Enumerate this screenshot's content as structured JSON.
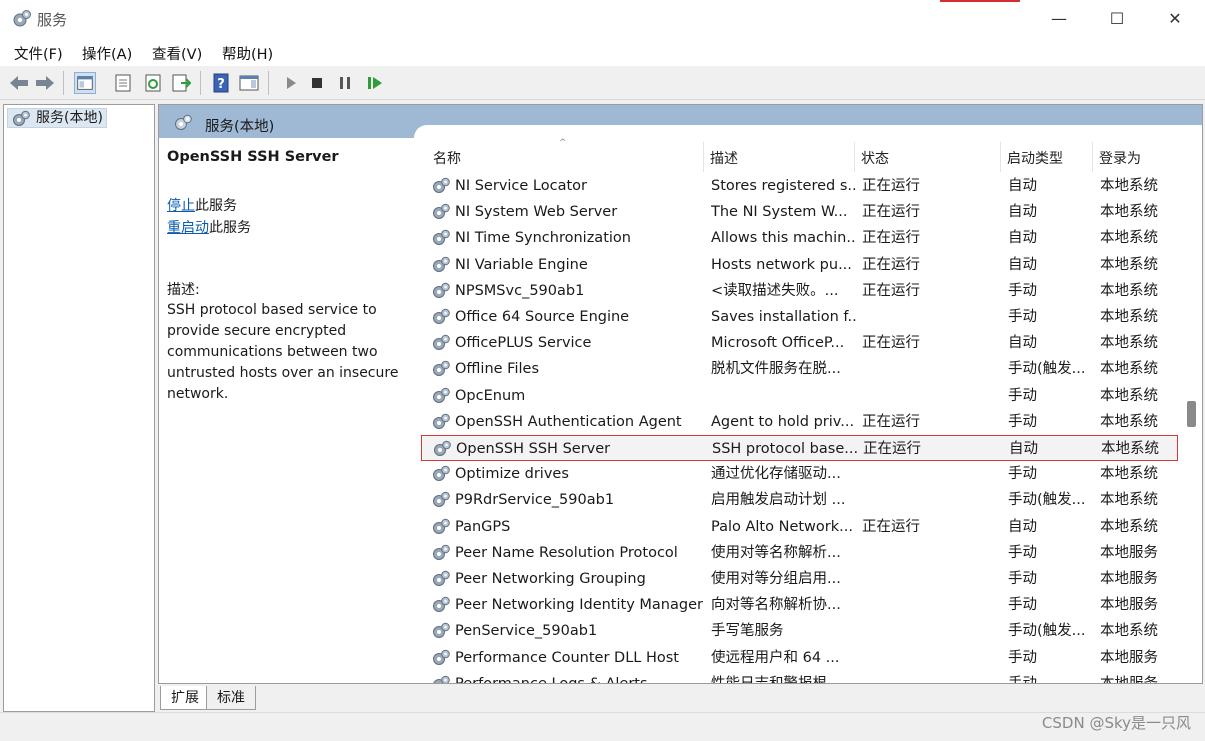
{
  "window": {
    "title": "服务",
    "minimize": "—",
    "maximize": "☐",
    "close": "✕"
  },
  "menu": [
    "文件(F)",
    "操作(A)",
    "查看(V)",
    "帮助(H)"
  ],
  "tree": {
    "root_label": "服务(本地)"
  },
  "pane_header": {
    "title": "服务(本地)"
  },
  "details": {
    "service_name": "OpenSSH SSH Server",
    "stop_link": "停止",
    "stop_suffix": "此服务",
    "restart_link": "重启动",
    "restart_suffix": "此服务",
    "desc_label": "描述:",
    "desc_text": "SSH protocol based service to provide secure encrypted communications between two untrusted hosts over an insecure network."
  },
  "columns": {
    "name": "名称",
    "desc": "描述",
    "status": "状态",
    "start": "启动类型",
    "logon": "登录为"
  },
  "rows": [
    [
      "NI Service Locator",
      "Stores registered s...",
      "正在运行",
      "自动",
      "本地系统"
    ],
    [
      "NI System Web Server",
      "The NI System W...",
      "正在运行",
      "自动",
      "本地系统"
    ],
    [
      "NI Time Synchronization",
      "Allows this machin...",
      "正在运行",
      "自动",
      "本地系统"
    ],
    [
      "NI Variable Engine",
      "Hosts network pu...",
      "正在运行",
      "自动",
      "本地系统"
    ],
    [
      "NPSMSvc_590ab1",
      "<读取描述失败。...",
      "正在运行",
      "手动",
      "本地系统"
    ],
    [
      "Office 64 Source Engine",
      "Saves installation f...",
      "",
      "手动",
      "本地系统"
    ],
    [
      "OfficePLUS Service",
      "Microsoft OfficeP...",
      "正在运行",
      "自动",
      "本地系统"
    ],
    [
      "Offline Files",
      "脱机文件服务在脱...",
      "",
      "手动(触发...",
      "本地系统"
    ],
    [
      "OpcEnum",
      "",
      "",
      "手动",
      "本地系统"
    ],
    [
      "OpenSSH Authentication Agent",
      "Agent to hold priv...",
      "正在运行",
      "手动",
      "本地系统"
    ],
    [
      "OpenSSH SSH Server",
      "SSH protocol base...",
      "正在运行",
      "自动",
      "本地系统"
    ],
    [
      "Optimize drives",
      "通过优化存储驱动...",
      "",
      "手动",
      "本地系统"
    ],
    [
      "P9RdrService_590ab1",
      "启用触发启动计划 ...",
      "",
      "手动(触发...",
      "本地系统"
    ],
    [
      "PanGPS",
      "Palo Alto Network...",
      "正在运行",
      "自动",
      "本地系统"
    ],
    [
      "Peer Name Resolution Protocol",
      "使用对等名称解析...",
      "",
      "手动",
      "本地服务"
    ],
    [
      "Peer Networking Grouping",
      "使用对等分组启用...",
      "",
      "手动",
      "本地服务"
    ],
    [
      "Peer Networking Identity Manager",
      "向对等名称解析协...",
      "",
      "手动",
      "本地服务"
    ],
    [
      "PenService_590ab1",
      "手写笔服务",
      "",
      "手动(触发...",
      "本地系统"
    ],
    [
      "Performance Counter DLL Host",
      "使远程用户和 64 ...",
      "",
      "手动",
      "本地服务"
    ],
    [
      "Performance Logs & Alerts",
      "性能日志和警报根...",
      "",
      "手动",
      "本地服务"
    ]
  ],
  "selected_row": 10,
  "tabs": {
    "extended": "扩展",
    "standard": "标准"
  },
  "watermark": "CSDN @Sky是一只风"
}
